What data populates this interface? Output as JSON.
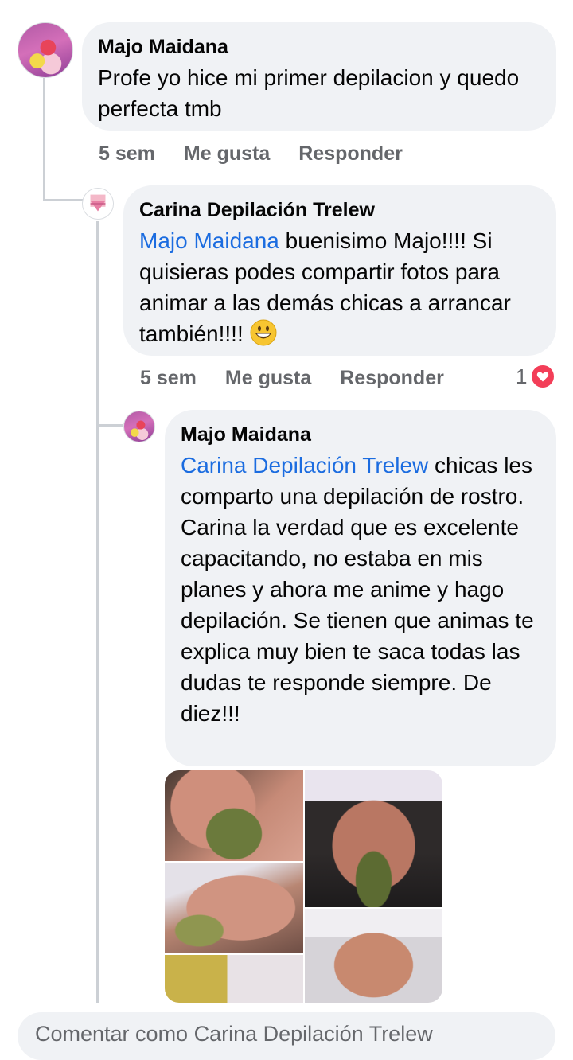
{
  "comments": [
    {
      "author": "Majo Maidana",
      "text": "Profe yo hice mi primer depilacion y quedo perfecta tmb",
      "time": "5 sem",
      "like_label": "Me gusta",
      "reply_label": "Responder"
    },
    {
      "author": "Carina Depilación Trelew",
      "mention": "Majo Maidana",
      "text": " buenisimo Majo!!!! Si quisieras podes compartir fotos para animar a las demás chicas a arrancar también!!!! ",
      "emoji": "grinning-face-emoji",
      "time": "5 sem",
      "like_label": "Me gusta",
      "reply_label": "Responder",
      "reaction_count": "1",
      "reaction_icon": "heart-icon"
    },
    {
      "author": "Majo Maidana",
      "mention": "Carina Depilación Trelew",
      "text": "  chicas les comparto una depilación de rostro. Carina la verdad que es excelente capacitando, no estaba en mis planes y ahora me anime y hago depilación. Se tienen que animas te explica muy bien te saca todas las dudas te responde siempre. De diez!!!"
    }
  ],
  "composer": {
    "placeholder": "Comentar como Carina Depilación Trelew"
  },
  "colors": {
    "bubble": "#f0f2f5",
    "mention": "#1b6ce0",
    "meta": "#65676b",
    "heart": "#f33e58"
  }
}
